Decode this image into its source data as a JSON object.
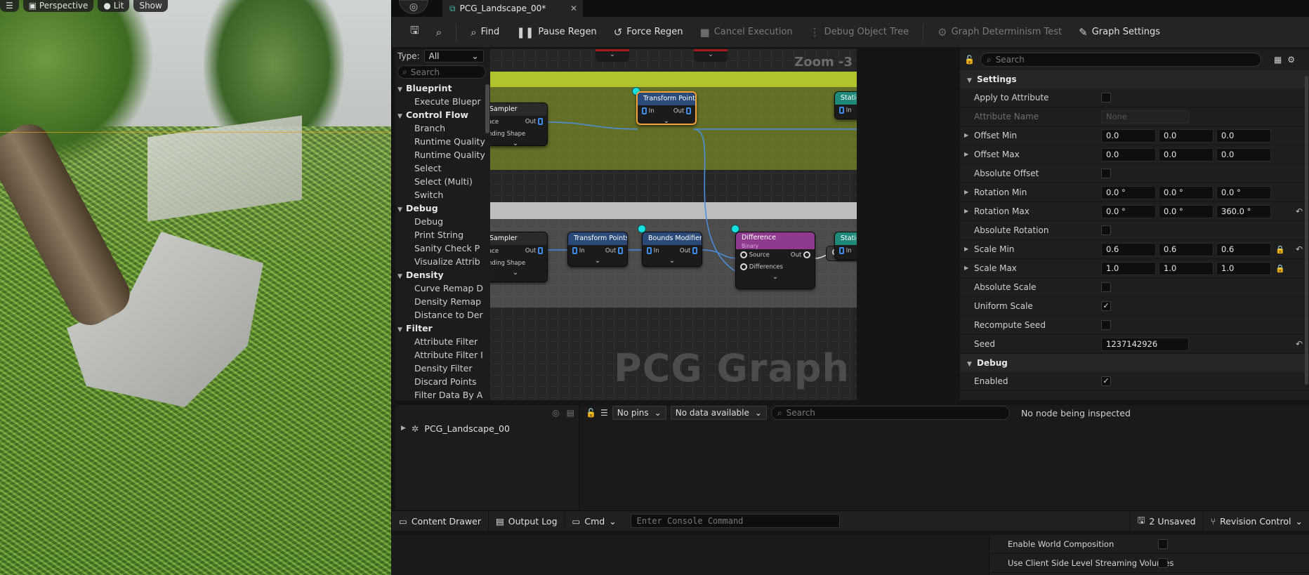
{
  "viewport": {
    "perspective": "Perspective",
    "lit": "Lit",
    "show": "Show"
  },
  "tab": {
    "title": "PCG_Landscape_00*",
    "close": "✕"
  },
  "toolbar": {
    "find": "Find",
    "pause_regen": "Pause Regen",
    "force_regen": "Force Regen",
    "cancel_execution": "Cancel Execution",
    "debug_object_tree": "Debug Object Tree",
    "graph_determinism_test": "Graph Determinism Test",
    "graph_settings": "Graph Settings"
  },
  "palette": {
    "type_label": "Type:",
    "type_value": "All",
    "search_placeholder": "Search",
    "categories": [
      {
        "name": "Blueprint",
        "items": [
          "Execute Bluepr"
        ]
      },
      {
        "name": "Control Flow",
        "items": [
          "Branch",
          "Runtime Quality",
          "Runtime Quality",
          "Select",
          "Select (Multi)",
          "Switch"
        ]
      },
      {
        "name": "Debug",
        "items": [
          "Debug",
          "Print String",
          "Sanity Check P",
          "Visualize Attrib"
        ]
      },
      {
        "name": "Density",
        "items": [
          "Curve Remap D",
          "Density Remap",
          "Distance to Der"
        ]
      },
      {
        "name": "Filter",
        "items": [
          "Attribute Filter",
          "Attribute Filter I",
          "Density Filter",
          "Discard Points",
          "Filter Data By A"
        ]
      }
    ]
  },
  "graph": {
    "zoom": "Zoom -3",
    "watermark": "PCG Graph",
    "nodes": {
      "sampler_top": {
        "title": "Sampler",
        "pin_in": "ace",
        "pin_out": "Out",
        "extra": "nding Shape"
      },
      "transform_top": {
        "title": "Transform Points",
        "pin_in": "In",
        "pin_out": "Out"
      },
      "static_top": {
        "title": "Static",
        "pin_in": "In"
      },
      "sampler_bottom": {
        "title": "Sampler",
        "pin_in": "ace",
        "pin_out": "Out",
        "extra": "nding Shape"
      },
      "transform_bottom": {
        "title": "Transform Points",
        "pin_in": "In",
        "pin_out": "Out"
      },
      "bounds_modifier": {
        "title": "Bounds Modifier",
        "pin_in": "In",
        "pin_out": "Out"
      },
      "difference": {
        "title": "Difference",
        "subtitle": "Binary",
        "pin_source": "Source",
        "pin_differences": "Differences",
        "pin_out": "Out"
      },
      "static_bottom": {
        "title": "Static",
        "pin_in": "In"
      }
    }
  },
  "details": {
    "search_placeholder": "Search",
    "sections": {
      "settings": "Settings",
      "debug": "Debug"
    },
    "props": {
      "apply_to_attribute": {
        "label": "Apply to Attribute",
        "checked": false
      },
      "attribute_name": {
        "label": "Attribute Name",
        "value": "None"
      },
      "offset_min": {
        "label": "Offset Min",
        "x": "0.0",
        "y": "0.0",
        "z": "0.0"
      },
      "offset_max": {
        "label": "Offset Max",
        "x": "0.0",
        "y": "0.0",
        "z": "0.0"
      },
      "absolute_offset": {
        "label": "Absolute Offset",
        "checked": false
      },
      "rotation_min": {
        "label": "Rotation Min",
        "x": "0.0 °",
        "y": "0.0 °",
        "z": "0.0 °"
      },
      "rotation_max": {
        "label": "Rotation Max",
        "x": "0.0 °",
        "y": "0.0 °",
        "z": "360.0 °"
      },
      "absolute_rotation": {
        "label": "Absolute Rotation",
        "checked": false
      },
      "scale_min": {
        "label": "Scale Min",
        "x": "0.6",
        "y": "0.6",
        "z": "0.6"
      },
      "scale_max": {
        "label": "Scale Max",
        "x": "1.0",
        "y": "1.0",
        "z": "1.0"
      },
      "absolute_scale": {
        "label": "Absolute Scale",
        "checked": false
      },
      "uniform_scale": {
        "label": "Uniform Scale",
        "checked": true
      },
      "recompute_seed": {
        "label": "Recompute Seed",
        "checked": false
      },
      "seed": {
        "label": "Seed",
        "value": "1237142926"
      },
      "enabled": {
        "label": "Enabled",
        "checked": true
      }
    }
  },
  "tree": {
    "root": "PCG_Landscape_00"
  },
  "inspector": {
    "pins": "No pins",
    "data": "No data available",
    "search_placeholder": "Search",
    "status": "No node being inspected"
  },
  "statusbar": {
    "content_drawer": "Content Drawer",
    "output_log": "Output Log",
    "cmd": "Cmd",
    "console_placeholder": "Enter Console Command",
    "unsaved": "2 Unsaved",
    "revision_control": "Revision Control"
  },
  "world_settings": {
    "enable_world_composition": "Enable World Composition",
    "client_side_streaming": "Use Client Side Level Streaming Volumes"
  },
  "colors": {
    "selection": "#f2a33a",
    "pin_blue": "#3d8de8",
    "comment_green": "#b1c42e",
    "difference_header": "#8e3a8e",
    "static_header": "#1f8a7a"
  }
}
